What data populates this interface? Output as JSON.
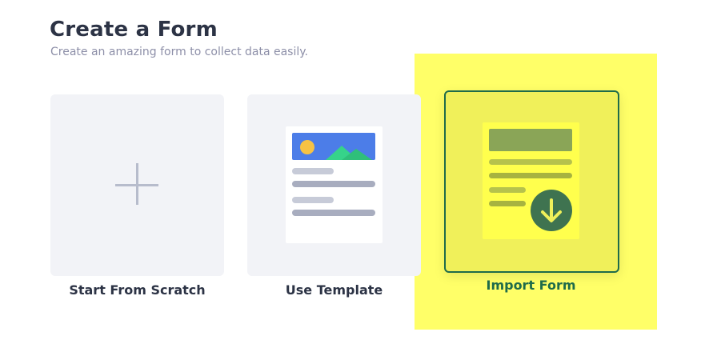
{
  "header": {
    "title": "Create a Form",
    "subtitle": "Create an amazing form to collect data easily."
  },
  "options": [
    {
      "label": "Start From Scratch",
      "icon": "plus-icon"
    },
    {
      "label": "Use Template",
      "icon": "template-document-icon"
    },
    {
      "label": "Import Form",
      "icon": "import-document-icon",
      "selected": true
    }
  ],
  "colors": {
    "title": "#2c3345",
    "subtitle": "#8d8fa8",
    "card_bg": "#f2f3f7",
    "highlight": "#ffff4d",
    "selected_border": "#1f6b4a",
    "template_image": "#4c7de8",
    "download_circle": "#3f7350"
  }
}
